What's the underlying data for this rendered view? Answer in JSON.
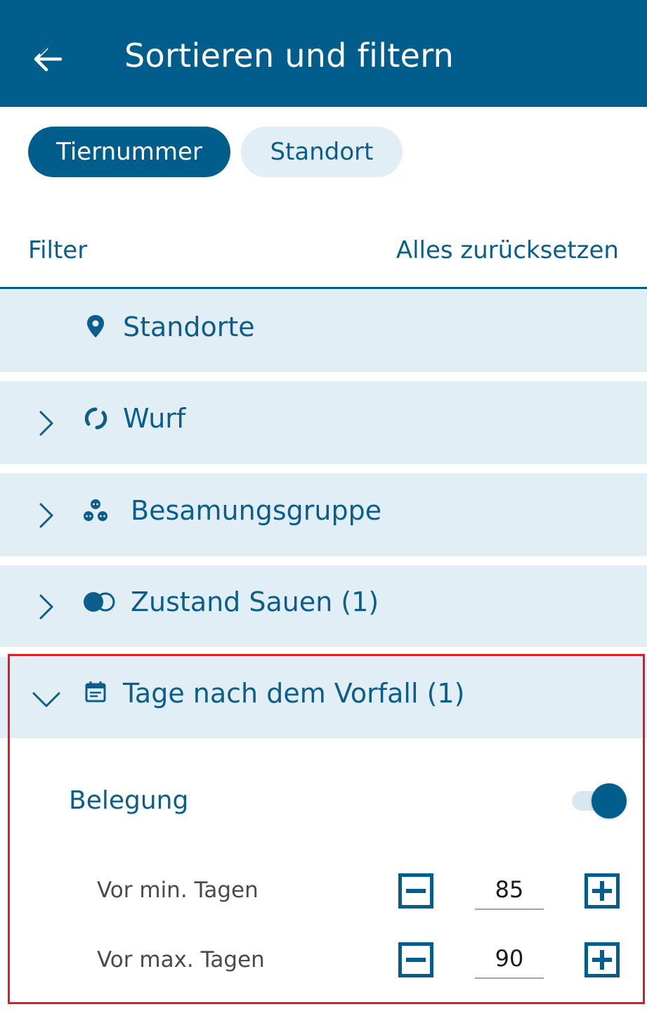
{
  "appbar": {
    "title": "Sortieren und filtern",
    "back_icon": "arrow-left-icon",
    "background": "#005d8c"
  },
  "sort_chips": [
    {
      "label": "Tiernummer",
      "selected": true
    },
    {
      "label": "Standort",
      "selected": false
    }
  ],
  "filter_header": {
    "label": "Filter",
    "reset_label": "Alles zurücksetzen"
  },
  "sections": [
    {
      "label": "Standorte",
      "icon": "location-pin-icon",
      "expanded": false
    },
    {
      "label": "Wurf",
      "icon": "circle-arrows-icon",
      "expanded": false
    },
    {
      "label": "Besamungsgruppe",
      "icon": "pig-group-icon",
      "expanded": false
    },
    {
      "label": "Zustand Sauen (1)",
      "icon": "toggle-circles-icon",
      "expanded": false
    },
    {
      "label": "Tage nach dem Vorfall (1)",
      "icon": "calendar-icon",
      "expanded": true
    }
  ],
  "expanded_panel": {
    "toggle_label": "Belegung",
    "toggle_on": true,
    "rows": [
      {
        "label": "Vor min. Tagen",
        "value": "85"
      },
      {
        "label": "Vor max. Tagen",
        "value": "90"
      }
    ]
  },
  "colors": {
    "primary": "#005d8c",
    "section_bg": "#e2eef5",
    "highlight": "#e01b24"
  }
}
